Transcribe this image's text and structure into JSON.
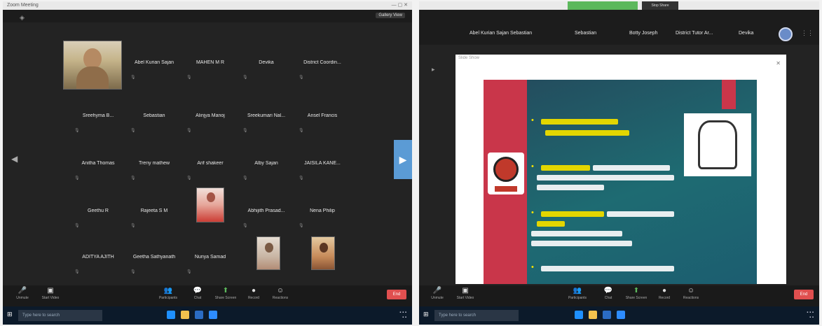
{
  "left_window": {
    "title": "Zoom Meeting",
    "view_button": "Gallery View",
    "participants": [
      {
        "name": "Abel Kurian Sajan"
      },
      {
        "name": "MAHEN M R"
      },
      {
        "name": "Devika"
      },
      {
        "name": "District Coordin..."
      },
      {
        "name": "Sreehyma B..."
      },
      {
        "name": "Sebastian"
      },
      {
        "name": "Alinjya Manoj"
      },
      {
        "name": "Sreekumari Nal..."
      },
      {
        "name": "Ansel Francis"
      },
      {
        "name": "Anitha Thomas"
      },
      {
        "name": "Treny mathew"
      },
      {
        "name": "Arif shakeer"
      },
      {
        "name": "Alby Sajan"
      },
      {
        "name": "JAISILA KANE..."
      },
      {
        "name": "Geethu R"
      },
      {
        "name": "Rajeeta S M"
      },
      {
        "name": "Abhijith Prasad..."
      },
      {
        "name": "Nena Philip"
      },
      {
        "name": "ADITYA AJITH"
      },
      {
        "name": "Geetha Sathyanath"
      },
      {
        "name": "Nuriya Samad"
      }
    ],
    "toolbar": {
      "unmute": "Unmute",
      "start_video": "Start Video",
      "participants": "Participants",
      "chat": "Chat",
      "share_screen": "Share Screen",
      "record": "Record",
      "reactions": "Reactions",
      "end": "End"
    },
    "taskbar_search": "Type here to search"
  },
  "right_window": {
    "top_tab": "Stop Share",
    "share_title": "Slide Show",
    "strip_names": [
      "Abel Kurian Sajan",
      "Sebastian",
      "Sebastian",
      "Botty Joseph",
      "District Tutor Ar...",
      "Devika"
    ],
    "toolbar": {
      "unmute": "Unmute",
      "start_video": "Start Video",
      "participants": "Participants",
      "chat": "Chat",
      "share_screen": "Share Screen",
      "record": "Record",
      "reactions": "Reactions",
      "end": "End"
    },
    "taskbar_search": "Type here to search"
  },
  "colors": {
    "zoom_bg": "#232323",
    "accent_blue": "#5b9bd5",
    "end_red": "#e04f4f",
    "slide_red": "#c9364a",
    "slide_teal": "#1e6b72",
    "slide_yellow": "#e3d600"
  },
  "icons": [
    "mic-off-icon",
    "video-off-icon",
    "participants-icon",
    "chat-icon",
    "share-screen-icon",
    "record-icon",
    "reactions-icon",
    "windows-start-icon",
    "search-icon"
  ]
}
